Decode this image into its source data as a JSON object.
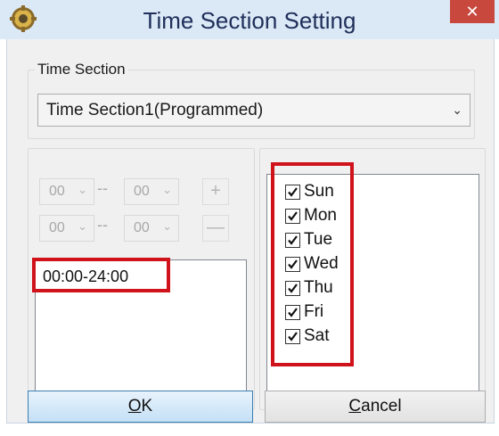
{
  "window": {
    "title": "Time Section Setting",
    "close_glyph": "✕",
    "icon": "app-gear-icon"
  },
  "time_section": {
    "group_label": "Time Section",
    "selected": "Time Section1(Programmed)"
  },
  "time_range": {
    "start_hour": "00",
    "start_minute": "00",
    "end_hour": "00",
    "end_minute": "00",
    "separator": "--",
    "add_glyph": "+",
    "remove_glyph": "—",
    "periods": [
      "00:00-24:00"
    ]
  },
  "days": [
    {
      "label": "Sun",
      "checked": true
    },
    {
      "label": "Mon",
      "checked": true
    },
    {
      "label": "Tue",
      "checked": true
    },
    {
      "label": "Wed",
      "checked": true
    },
    {
      "label": "Thu",
      "checked": true
    },
    {
      "label": "Fri",
      "checked": true
    },
    {
      "label": "Sat",
      "checked": true
    }
  ],
  "buttons": {
    "ok_mnemonic": "O",
    "ok_rest": "K",
    "cancel_mnemonic": "C",
    "cancel_rest": "ancel"
  },
  "colors": {
    "highlight": "#d0121b",
    "titlebar": "#dbe8f6",
    "close": "#c9483e"
  }
}
